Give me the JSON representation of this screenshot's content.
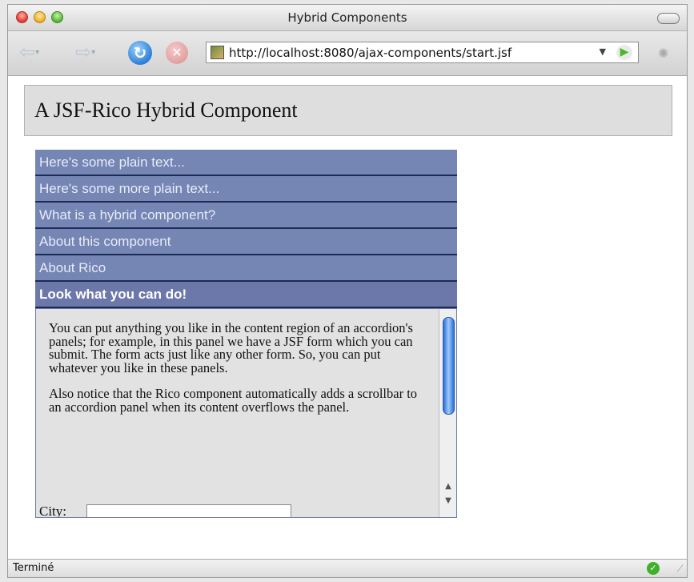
{
  "window": {
    "title": "Hybrid Components"
  },
  "toolbar": {
    "url": "http://localhost:8080/ajax-components/start.jsf",
    "back_icon": "back-arrow-icon",
    "forward_icon": "forward-arrow-icon",
    "reload_icon": "reload-icon",
    "stop_icon": "stop-icon",
    "go_icon": "go-arrow-icon"
  },
  "page": {
    "heading": "A JSF-Rico Hybrid Component",
    "accordion": {
      "headers": [
        "Here's some plain text...",
        "Here's some more plain text...",
        "What is a hybrid component?",
        "About this component",
        "About Rico",
        "Look what you can do!"
      ],
      "active_index": 5,
      "panel_paragraphs": [
        "You can put anything you like in the content region of an accordion's panels; for example, in this panel we have a JSF form which you can submit. The form acts just like any other form. So, you can put whatever you like in these panels.",
        "Also notice that the Rico component automatically adds a scrollbar to an accordion panel when its content overflows the panel."
      ],
      "city_label": "City:",
      "city_value": ""
    }
  },
  "status": {
    "text": "Terminé"
  },
  "colors": {
    "accordion_header": "#7585b4",
    "accordion_active": "#6c77aa",
    "panel_bg": "#e2e2e2"
  }
}
